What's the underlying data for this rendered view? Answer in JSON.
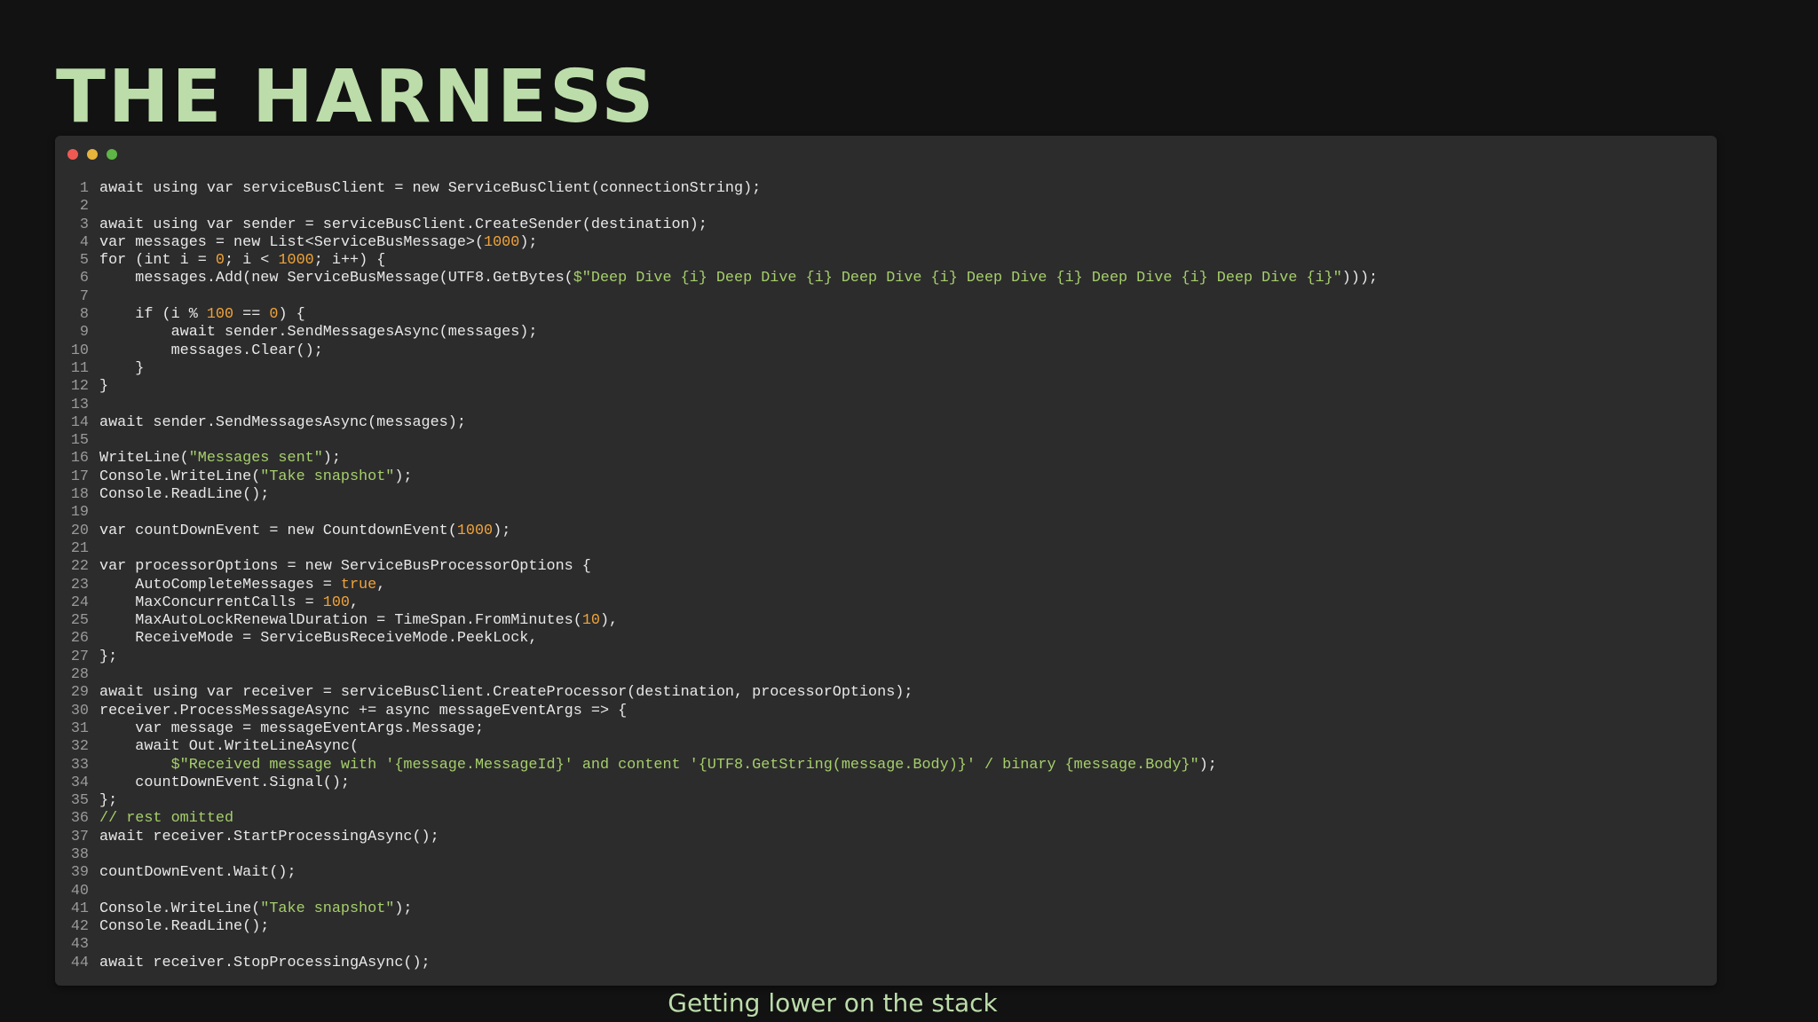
{
  "slide": {
    "title": "THE HARNESS",
    "caption": "Getting lower on the stack"
  },
  "window": {
    "controls": [
      "close",
      "minimize",
      "maximize"
    ]
  },
  "colors": {
    "title": "#bcdcaa",
    "background": "#121212",
    "editor_background": "#2c2c2c",
    "string": "#a6cf6b",
    "number": "#f0a33a",
    "comment": "#a6cf6b",
    "line_number": "#9a9a9a",
    "close": "#ee5a52",
    "minimize": "#e6b53c",
    "maximize": "#5fb545"
  },
  "code": {
    "language": "csharp",
    "lines": [
      [
        [
          "plain",
          "await using var serviceBusClient = new ServiceBusClient(connectionString);"
        ]
      ],
      [],
      [
        [
          "plain",
          "await using var sender = serviceBusClient.CreateSender(destination);"
        ]
      ],
      [
        [
          "plain",
          "var messages = new List<ServiceBusMessage>("
        ],
        [
          "num",
          "1000"
        ],
        [
          "plain",
          ");"
        ]
      ],
      [
        [
          "plain",
          "for (int i = "
        ],
        [
          "num",
          "0"
        ],
        [
          "plain",
          "; i < "
        ],
        [
          "num",
          "1000"
        ],
        [
          "plain",
          "; i++) {"
        ]
      ],
      [
        [
          "plain",
          "    messages.Add(new ServiceBusMessage(UTF8.GetBytes("
        ],
        [
          "str",
          "$\"Deep Dive {i} Deep Dive {i} Deep Dive {i} Deep Dive {i} Deep Dive {i} Deep Dive {i}\""
        ],
        [
          "plain",
          ")));"
        ]
      ],
      [],
      [
        [
          "plain",
          "    if (i % "
        ],
        [
          "num",
          "100"
        ],
        [
          "plain",
          " == "
        ],
        [
          "num",
          "0"
        ],
        [
          "plain",
          ") {"
        ]
      ],
      [
        [
          "plain",
          "        await sender.SendMessagesAsync(messages);"
        ]
      ],
      [
        [
          "plain",
          "        messages.Clear();"
        ]
      ],
      [
        [
          "plain",
          "    }"
        ]
      ],
      [
        [
          "plain",
          "}"
        ]
      ],
      [],
      [
        [
          "plain",
          "await sender.SendMessagesAsync(messages);"
        ]
      ],
      [],
      [
        [
          "plain",
          "WriteLine("
        ],
        [
          "str",
          "\"Messages sent\""
        ],
        [
          "plain",
          ");"
        ]
      ],
      [
        [
          "plain",
          "Console.WriteLine("
        ],
        [
          "str",
          "\"Take snapshot\""
        ],
        [
          "plain",
          ");"
        ]
      ],
      [
        [
          "plain",
          "Console.ReadLine();"
        ]
      ],
      [],
      [
        [
          "plain",
          "var countDownEvent = new CountdownEvent("
        ],
        [
          "num",
          "1000"
        ],
        [
          "plain",
          ");"
        ]
      ],
      [],
      [
        [
          "plain",
          "var processorOptions = new ServiceBusProcessorOptions {"
        ]
      ],
      [
        [
          "plain",
          "    AutoCompleteMessages = "
        ],
        [
          "num",
          "true"
        ],
        [
          "plain",
          ","
        ]
      ],
      [
        [
          "plain",
          "    MaxConcurrentCalls = "
        ],
        [
          "num",
          "100"
        ],
        [
          "plain",
          ","
        ]
      ],
      [
        [
          "plain",
          "    MaxAutoLockRenewalDuration = TimeSpan.FromMinutes("
        ],
        [
          "num",
          "10"
        ],
        [
          "plain",
          "),"
        ]
      ],
      [
        [
          "plain",
          "    ReceiveMode = ServiceBusReceiveMode.PeekLock,"
        ]
      ],
      [
        [
          "plain",
          "};"
        ]
      ],
      [],
      [
        [
          "plain",
          "await using var receiver = serviceBusClient.CreateProcessor(destination, processorOptions);"
        ]
      ],
      [
        [
          "plain",
          "receiver.ProcessMessageAsync += async messageEventArgs => {"
        ]
      ],
      [
        [
          "plain",
          "    var message = messageEventArgs.Message;"
        ]
      ],
      [
        [
          "plain",
          "    await Out.WriteLineAsync("
        ]
      ],
      [
        [
          "plain",
          "        "
        ],
        [
          "str",
          "$\"Received message with '{message.MessageId}' and content '{UTF8.GetString(message.Body)}' / binary {message.Body}\""
        ],
        [
          "plain",
          ");"
        ]
      ],
      [
        [
          "plain",
          "    countDownEvent.Signal();"
        ]
      ],
      [
        [
          "plain",
          "};"
        ]
      ],
      [
        [
          "com",
          "// rest omitted"
        ]
      ],
      [
        [
          "plain",
          "await receiver.StartProcessingAsync();"
        ]
      ],
      [],
      [
        [
          "plain",
          "countDownEvent.Wait();"
        ]
      ],
      [],
      [
        [
          "plain",
          "Console.WriteLine("
        ],
        [
          "str",
          "\"Take snapshot\""
        ],
        [
          "plain",
          ");"
        ]
      ],
      [
        [
          "plain",
          "Console.ReadLine();"
        ]
      ],
      [],
      [
        [
          "plain",
          "await receiver.StopProcessingAsync();"
        ]
      ]
    ]
  }
}
